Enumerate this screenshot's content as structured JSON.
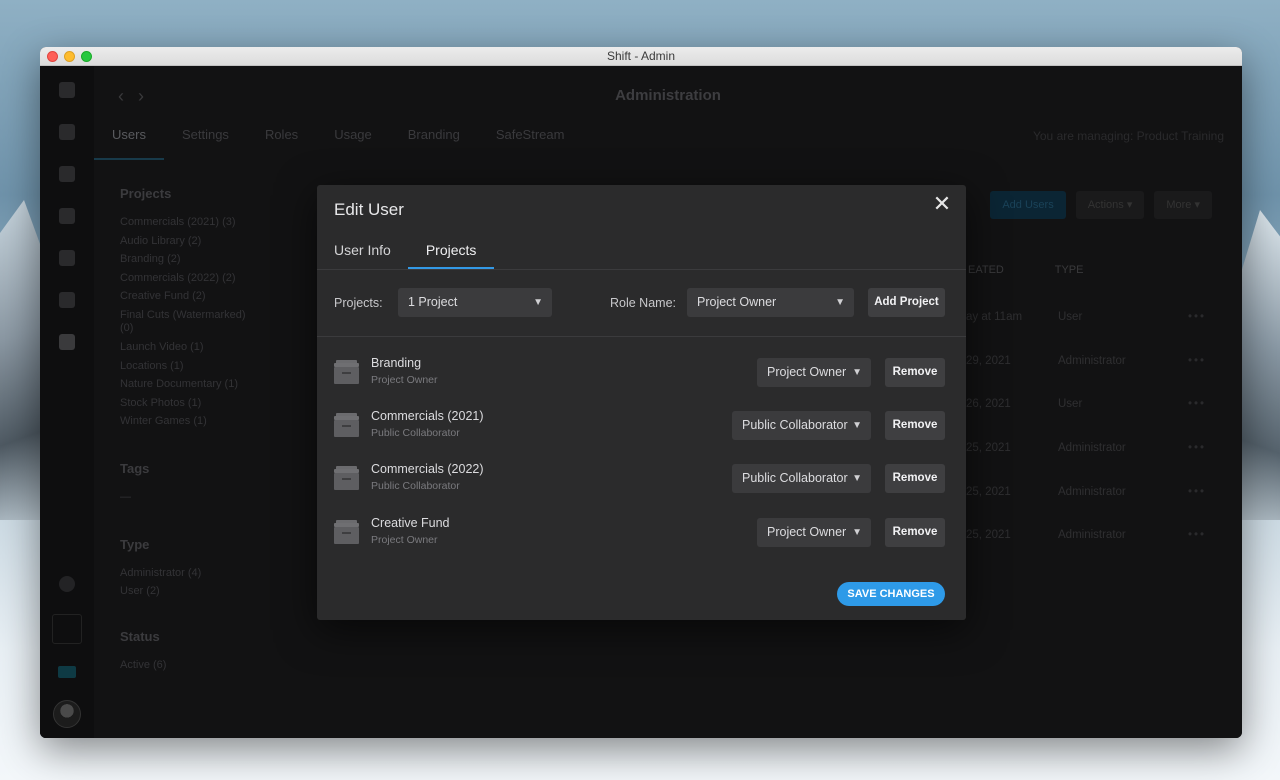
{
  "window": {
    "title": "Shift - Admin"
  },
  "app": {
    "title": "Administration",
    "tabs": [
      {
        "label": "Users"
      },
      {
        "label": "Settings"
      },
      {
        "label": "Roles"
      },
      {
        "label": "Usage"
      },
      {
        "label": "Branding"
      },
      {
        "label": "SafeStream"
      }
    ],
    "managing": "You are managing: Product Training"
  },
  "filters": {
    "projects_title": "Projects",
    "projects": [
      "Commercials (2021) (3)",
      "Audio Library (2)",
      "Branding (2)",
      "Commercials (2022) (2)",
      "Creative Fund (2)",
      "Final Cuts (Watermarked)",
      "(0)",
      "Launch Video (1)",
      "Locations (1)",
      "Nature Documentary (1)",
      "Stock Photos (1)",
      "Winter Games (1)"
    ],
    "tags_title": "Tags",
    "tags_empty": "—",
    "type_title": "Type",
    "types": [
      "Administrator (4)",
      "User (2)"
    ],
    "status_title": "Status",
    "statuses": [
      "Active (6)"
    ]
  },
  "background_table": {
    "add_users": "Add Users",
    "actions": "Actions",
    "more": "More",
    "col_created": "EATED",
    "col_type": "TYPE",
    "rows": [
      {
        "created": "ay at 11am",
        "type": "User"
      },
      {
        "created": "29, 2021",
        "type": "Administrator"
      },
      {
        "created": "26, 2021",
        "type": "User"
      },
      {
        "created": "25, 2021",
        "type": "Administrator"
      },
      {
        "created": "25, 2021",
        "type": "Administrator"
      },
      {
        "created": "25, 2021",
        "type": "Administrator"
      }
    ],
    "row_menu": "•••"
  },
  "modal": {
    "title": "Edit User",
    "close_glyph": "✕",
    "tabs": [
      {
        "label": "User Info"
      },
      {
        "label": "Projects"
      }
    ],
    "projects_label": "Projects:",
    "projects_value": "1 Project",
    "role_label": "Role Name:",
    "role_value": "Project Owner",
    "add_project": "Add Project",
    "items": [
      {
        "name": "Branding",
        "role": "Project Owner",
        "select": "Project Owner",
        "remove": "Remove"
      },
      {
        "name": "Commercials (2021)",
        "role": "Public Collaborator",
        "select": "Public Collaborator",
        "remove": "Remove"
      },
      {
        "name": "Commercials (2022)",
        "role": "Public Collaborator",
        "select": "Public Collaborator",
        "remove": "Remove"
      },
      {
        "name": "Creative Fund",
        "role": "Project Owner",
        "select": "Project Owner",
        "remove": "Remove"
      }
    ],
    "save": "SAVE CHANGES"
  },
  "icons": {
    "chevron": "chevron-down-icon",
    "box": "archive-box-icon",
    "close": "close-icon"
  },
  "colors": {
    "accent": "#2e9ae8",
    "modal_bg": "#2b2b2c",
    "select_bg": "#3b3b3d"
  }
}
